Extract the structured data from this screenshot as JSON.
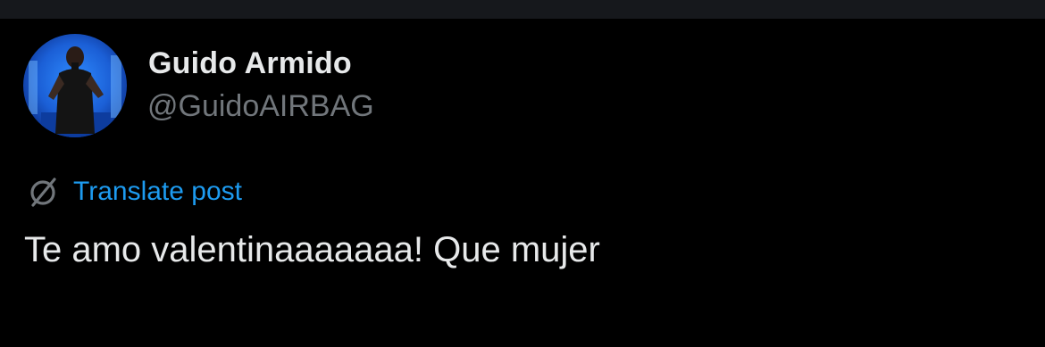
{
  "author": {
    "display_name": "Guido Armido",
    "handle": "@GuidoAIRBAG"
  },
  "translate": {
    "icon": "translate-slash-icon",
    "label": "Translate post"
  },
  "post": {
    "text": "Te amo valentinaaaaaaa! Que mujer"
  },
  "colors": {
    "background": "#000000",
    "text_primary": "#e7e9ea",
    "text_secondary": "#71767b",
    "link": "#1d9bf0"
  }
}
